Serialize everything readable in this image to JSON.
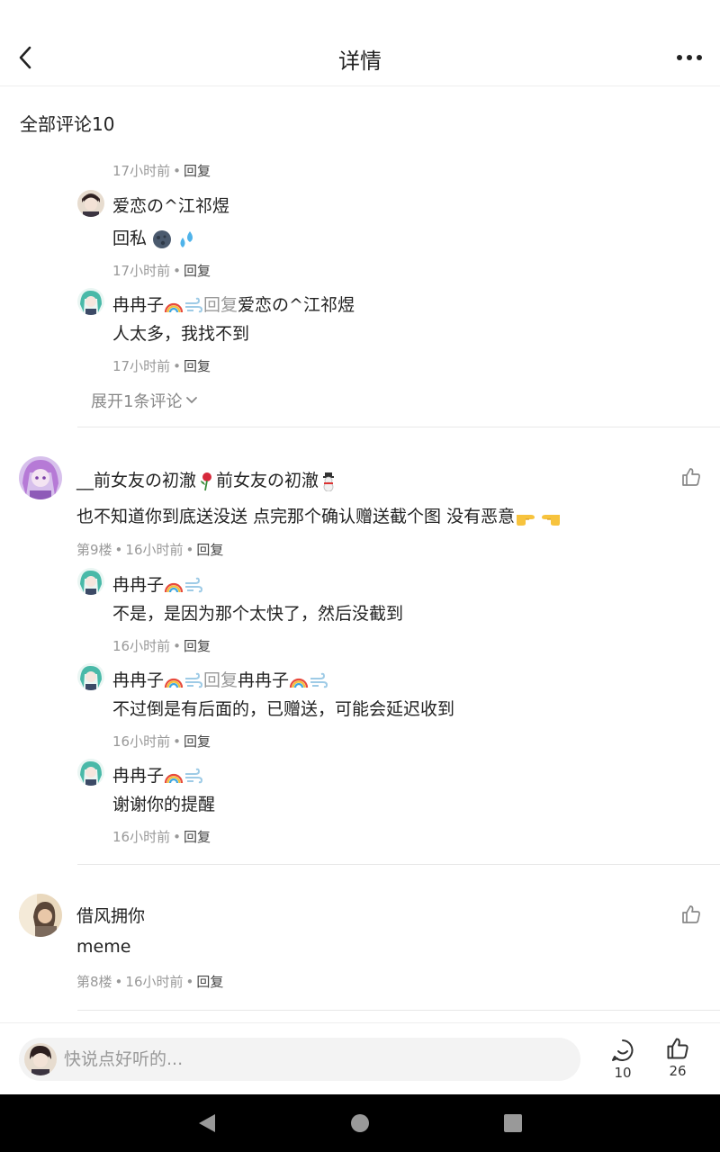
{
  "header": {
    "title": "详情"
  },
  "comments_header": "全部评论10",
  "thread1": {
    "top_meta": {
      "time": "17小时前",
      "reply": "回复"
    },
    "replies": [
      {
        "name": "爱恋の^江祁煜",
        "text": "回私",
        "time": "17小时前",
        "reply": "回复"
      },
      {
        "name": "冉冉子",
        "reply_word": "回复",
        "target": "爱恋の^江祁煜",
        "text": "人太多，我找不到",
        "time": "17小时前",
        "reply": "回复"
      }
    ],
    "expand": "展开1条评论"
  },
  "comment9": {
    "name": "__前女友の初澈",
    "text": "也不知道你到底送没送 点完那个确认赠送截个图 没有恶意",
    "floor": "第9楼",
    "time": "16小时前",
    "reply": "回复",
    "replies": [
      {
        "name": "冉冉子",
        "text": "不是，是因为那个太快了，然后没截到",
        "time": "16小时前",
        "reply": "回复"
      },
      {
        "name": "冉冉子",
        "reply_word": "回复",
        "target": "冉冉子",
        "text": "不过倒是有后面的，已赠送，可能会延迟收到",
        "time": "16小时前",
        "reply": "回复"
      },
      {
        "name": "冉冉子",
        "text": "谢谢你的提醒",
        "time": "16小时前",
        "reply": "回复"
      }
    ]
  },
  "comment8": {
    "name": "借风拥你",
    "text": "meme",
    "floor": "第8楼",
    "time": "16小时前",
    "reply": "回复"
  },
  "bottom": {
    "placeholder": "快说点好听的...",
    "comment_count": "10",
    "like_count": "26"
  },
  "icons": {
    "back": "chevron-left-icon",
    "more": "more-dots-icon",
    "like": "thumbs-up-icon",
    "comment": "comment-bubble-icon"
  },
  "colors": {
    "text": "#222222",
    "muted": "#999999",
    "teal_avatar": "#49b9a8",
    "purple_avatar": "#b67ad6"
  }
}
